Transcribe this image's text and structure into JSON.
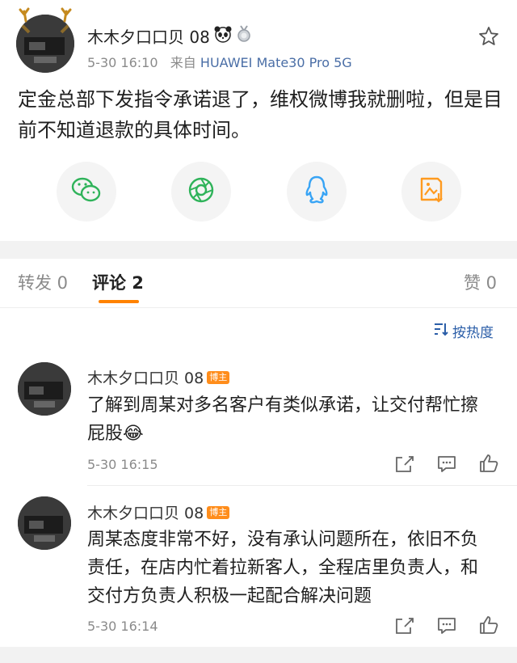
{
  "post": {
    "author": "木木夕口口贝 08",
    "time": "5-30 16:10",
    "source_prefix": "来自",
    "device": "HUAWEI Mate30 Pro 5G",
    "text": "定金总部下发指令承诺退了，维权微博我就删啦，但是目前不知道退款的具体时间。"
  },
  "share": [
    {
      "icon": "wechat-icon",
      "color": "#2fb35a"
    },
    {
      "icon": "moments-icon",
      "color": "#2fb35a"
    },
    {
      "icon": "qq-icon",
      "color": "#38a4f5"
    },
    {
      "icon": "save-image-icon",
      "color": "#ff9a1f"
    }
  ],
  "tabs": {
    "repost": "转发 0",
    "comments": "评论 2",
    "likes": "赞 0"
  },
  "sort": {
    "label": "按热度"
  },
  "comments": [
    {
      "author": "木木夕口口贝 08",
      "badge": "博主",
      "text": "了解到周某对多名客户有类似承诺，让交付帮忙擦屁股😂",
      "time": "5-30 16:15"
    },
    {
      "author": "木木夕口口贝 08",
      "badge": "博主",
      "text": "周某态度非常不好，没有承认问题所在，依旧不负责任，在店内忙着拉新客人，全程店里负责人，和交付方负责人积极一起配合解决问题",
      "time": "5-30 16:14"
    }
  ],
  "colors": {
    "accent": "#ff8200",
    "link": "#2b5ea8",
    "badge": "#ff8d1b"
  }
}
